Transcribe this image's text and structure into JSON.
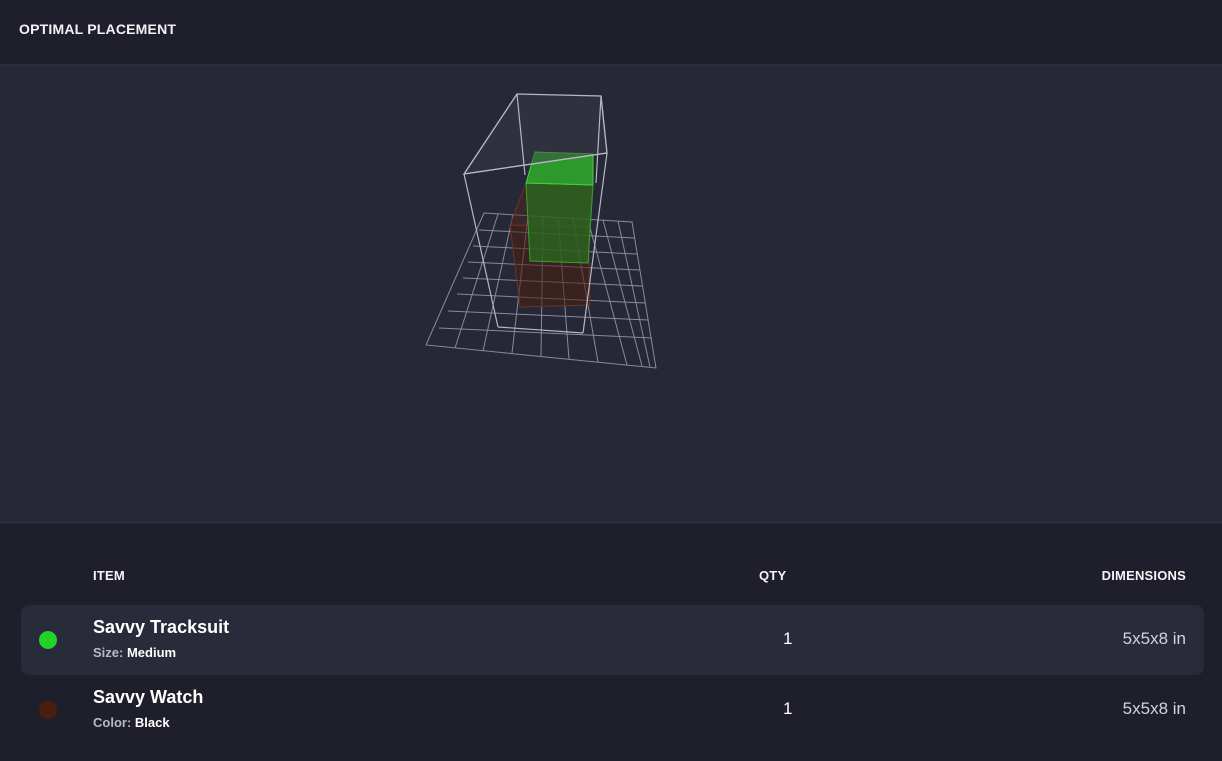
{
  "header": {
    "title": "OPTIMAL PLACEMENT"
  },
  "colors": {
    "tracksuit": "#1fd327",
    "watch": "#4a1d0f",
    "background": "#1f1f2b",
    "viewer_background": "#262838",
    "row_highlight": "#292a3a"
  },
  "table": {
    "columns": {
      "item": "ITEM",
      "qty": "QTY",
      "dimensions": "DIMENSIONS"
    },
    "rows": [
      {
        "name": "Savvy Tracksuit",
        "attr_label": "Size:",
        "attr_value": "Medium",
        "qty": "1",
        "dimensions": "5x5x8 in"
      },
      {
        "name": "Savvy Watch",
        "attr_label": "Color:",
        "attr_value": "Black",
        "qty": "1",
        "dimensions": "5x5x8 in"
      }
    ]
  }
}
